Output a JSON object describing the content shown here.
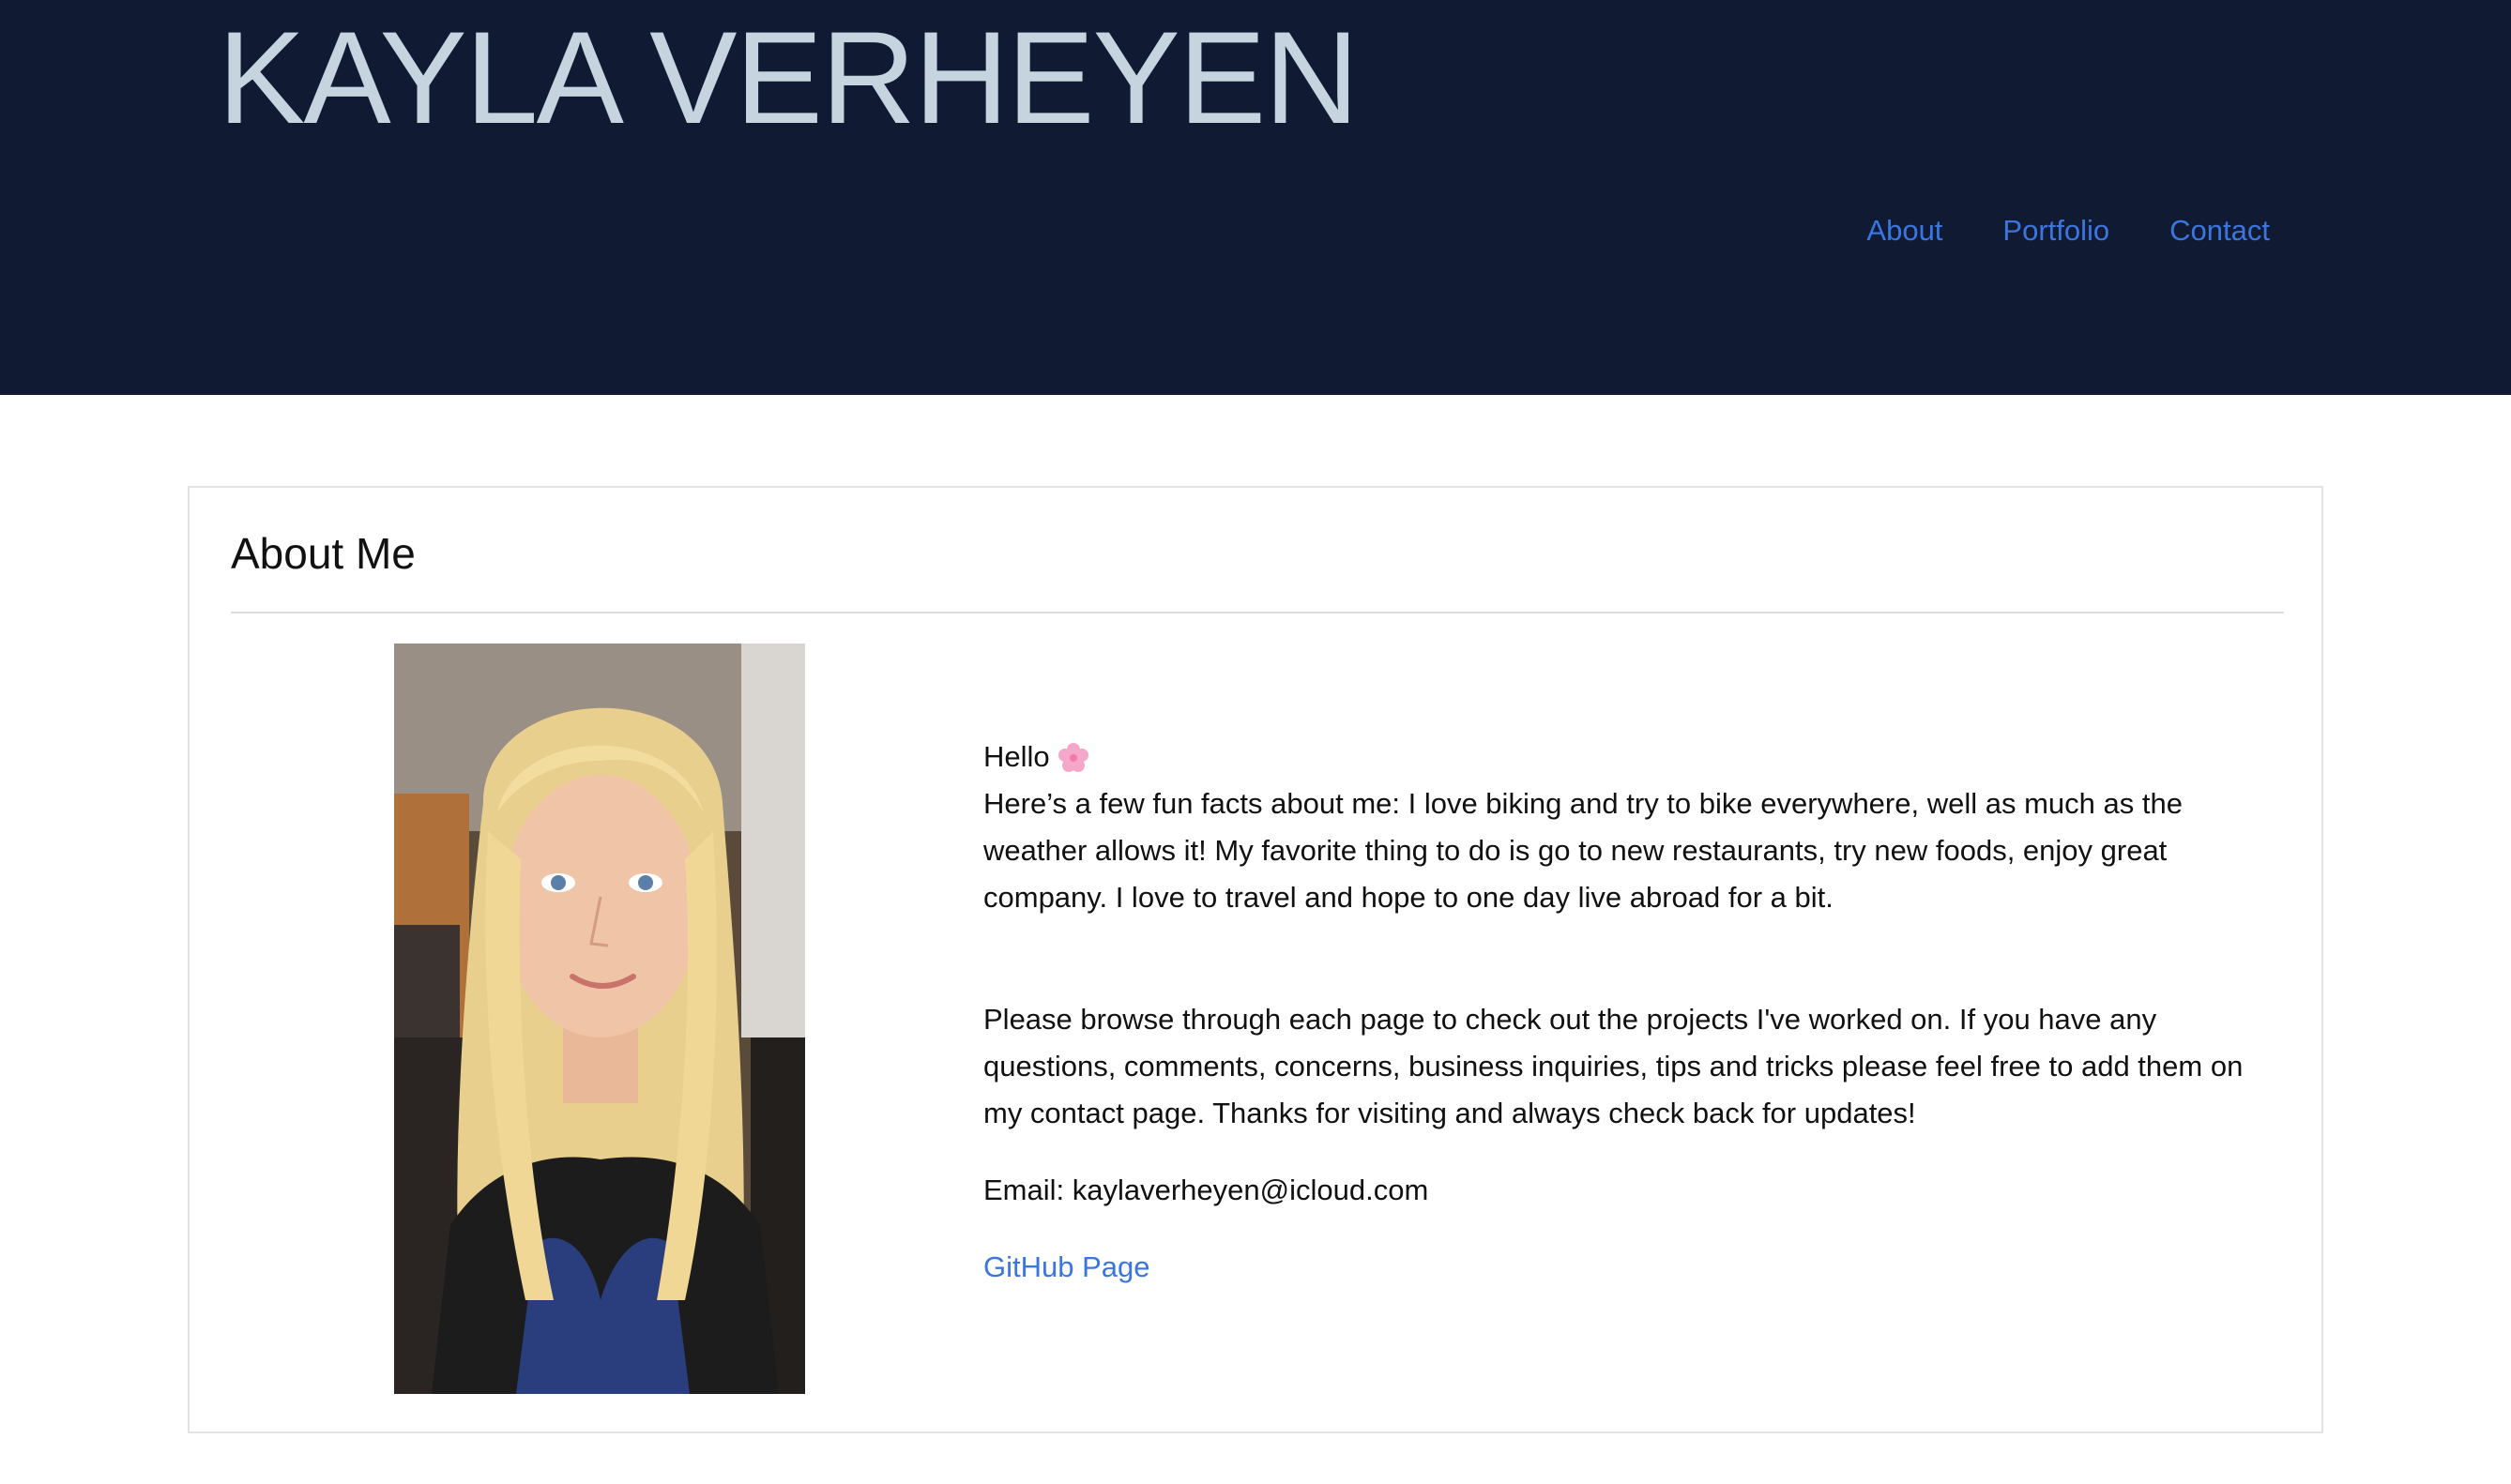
{
  "header": {
    "site_title": "KAYLA VERHEYEN",
    "nav": [
      {
        "label": "About"
      },
      {
        "label": "Portfolio"
      },
      {
        "label": "Contact"
      }
    ]
  },
  "about": {
    "title": "About Me",
    "hello": "Hello",
    "hello_icon": "cherry-blossom-icon",
    "paragraph1": "Here’s a few fun facts about me: I love biking and try to bike everywhere, well as much as the weather allows it! My favorite thing to do is go to new restaurants, try new foods, enjoy great company. I love to travel and hope to one day live abroad for a bit.",
    "paragraph2": "Please browse through each page to check out the projects I've worked on. If you have any questions, comments, concerns, business inquiries, tips and tricks please feel free to add them on my contact page. Thanks for visiting and always check back for updates!",
    "email": "Email: kaylaverheyen@icloud.com",
    "github_label": "GitHub Page"
  },
  "colors": {
    "header_bg": "#101b33",
    "title_color": "#c6d4df",
    "link_color": "#3b76e0"
  }
}
